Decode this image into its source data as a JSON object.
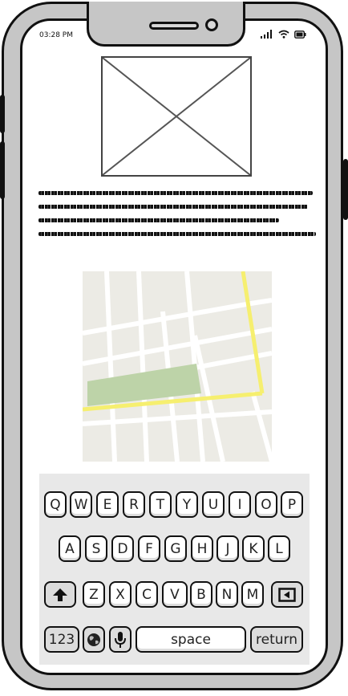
{
  "status_bar": {
    "time": "03:28 PM",
    "icons": [
      "signal-icon",
      "wifi-icon",
      "battery-icon"
    ]
  },
  "content": {
    "image_placeholder": "image-placeholder",
    "map": "map-placeholder"
  },
  "keyboard": {
    "row1": [
      "Q",
      "W",
      "E",
      "R",
      "T",
      "Y",
      "U",
      "I",
      "O",
      "P"
    ],
    "row2": [
      "A",
      "S",
      "D",
      "F",
      "G",
      "H",
      "J",
      "K",
      "L"
    ],
    "row3": [
      "Z",
      "X",
      "C",
      "V",
      "B",
      "N",
      "M"
    ],
    "numbers_label": "123",
    "space_label": "space",
    "return_label": "return"
  },
  "colors": {
    "device_gray": "#c6c6c6",
    "map_bg": "#ecebe5",
    "map_road_major": "#f6ef6f",
    "map_park": "#bdd3a8",
    "keyboard_bg": "#e8e8e8"
  }
}
